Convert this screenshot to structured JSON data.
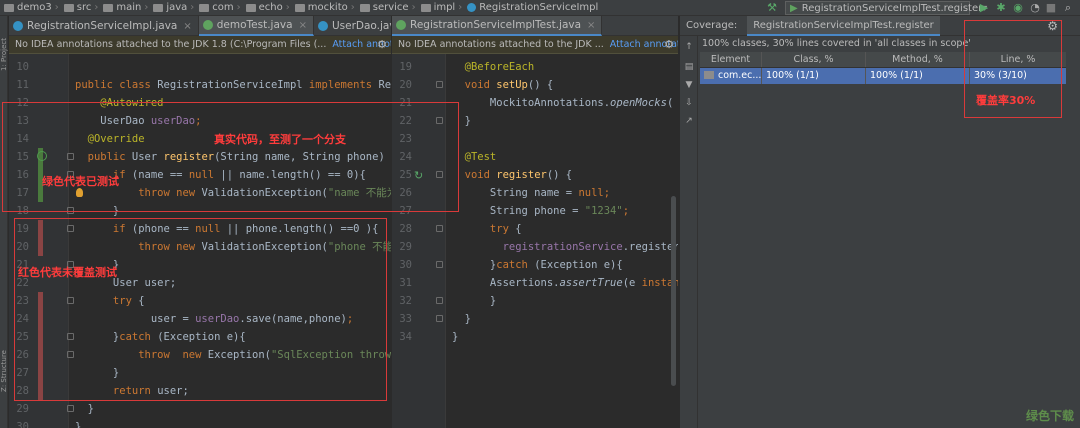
{
  "breadcrumb": [
    "demo3",
    "src",
    "main",
    "java",
    "com",
    "echo",
    "mockito",
    "service",
    "impl",
    "RegistrationServiceImpl"
  ],
  "toolbar": {
    "run_config": "RegistrationServiceImplTest.register"
  },
  "left_strip": {
    "project_label": "1: Project",
    "structure_label": "Z: Structure"
  },
  "left_editor": {
    "tabs": [
      {
        "label": "RegistrationServiceImpl.java",
        "active": false
      },
      {
        "label": "demoTest.java",
        "active": true
      },
      {
        "label": "UserDao.java",
        "active": false
      }
    ],
    "banner_text": "No IDEA annotations attached to the JDK 1.8 (C:\\Program Files (...",
    "banner_link": "Attach annotations",
    "lines": [
      {
        "n": "10",
        "segs": []
      },
      {
        "n": "11",
        "segs": [
          [
            "kw",
            "public class "
          ],
          [
            "id",
            "RegistrationServiceImpl "
          ],
          [
            "kw",
            "implements "
          ],
          [
            "id",
            "Registra"
          ]
        ]
      },
      {
        "n": "12",
        "segs": [
          [
            "ann",
            "    @Autowired"
          ]
        ]
      },
      {
        "n": "13",
        "segs": [
          [
            "id",
            "    UserDao "
          ],
          [
            "fld",
            "userDao"
          ],
          [
            "kw",
            ";"
          ]
        ]
      },
      {
        "n": "14",
        "segs": [
          [
            "ann",
            "  @Override"
          ]
        ]
      },
      {
        "n": "15",
        "segs": [
          [
            "kw",
            "  public "
          ],
          [
            "id",
            "User "
          ],
          [
            "fn",
            "register"
          ],
          [
            "id",
            "(String name, String phone) "
          ],
          [
            "kw",
            "thro"
          ]
        ]
      },
      {
        "n": "16",
        "segs": [
          [
            "kw",
            "      if "
          ],
          [
            "id",
            "(name == "
          ],
          [
            "kw",
            "null "
          ],
          [
            "id",
            "|| name.length() == "
          ],
          [
            "id",
            "0"
          ],
          [
            "id",
            "){"
          ]
        ]
      },
      {
        "n": "17",
        "segs": [
          [
            "kw",
            "          throw new "
          ],
          [
            "id",
            "ValidationException("
          ],
          [
            "str",
            "\"name 不能为空"
          ]
        ]
      },
      {
        "n": "18",
        "segs": [
          [
            "id",
            "      }"
          ]
        ]
      },
      {
        "n": "19",
        "segs": [
          [
            "kw",
            "      if "
          ],
          [
            "id",
            "(phone == "
          ],
          [
            "kw",
            "null "
          ],
          [
            "id",
            "|| phone.length() ==0 ){"
          ]
        ]
      },
      {
        "n": "20",
        "segs": [
          [
            "kw",
            "          throw new "
          ],
          [
            "id",
            "ValidationException("
          ],
          [
            "str",
            "\"phone 不能为空"
          ]
        ]
      },
      {
        "n": "21",
        "segs": [
          [
            "id",
            "      }"
          ]
        ]
      },
      {
        "n": "22",
        "segs": [
          [
            "id",
            "      User user;"
          ]
        ]
      },
      {
        "n": "23",
        "segs": [
          [
            "kw",
            "      try "
          ],
          [
            "id",
            "{"
          ]
        ]
      },
      {
        "n": "24",
        "segs": [
          [
            "id",
            "            user = "
          ],
          [
            "fld",
            "userDao"
          ],
          [
            "id",
            ".save(name,phone)"
          ],
          [
            "kw",
            ";"
          ]
        ]
      },
      {
        "n": "25",
        "segs": [
          [
            "id",
            "      }"
          ],
          [
            "kw",
            "catch "
          ],
          [
            "id",
            "(Exception e){"
          ]
        ]
      },
      {
        "n": "26",
        "segs": [
          [
            "kw",
            "          throw  new "
          ],
          [
            "id",
            "Exception("
          ],
          [
            "str",
            "\"SqlException thrown\""
          ]
        ]
      },
      {
        "n": "27",
        "segs": [
          [
            "id",
            "      }"
          ]
        ]
      },
      {
        "n": "28",
        "segs": [
          [
            "kw",
            "      return "
          ],
          [
            "id",
            "user;"
          ]
        ]
      },
      {
        "n": "29",
        "segs": [
          [
            "id",
            "  }"
          ]
        ]
      },
      {
        "n": "30",
        "segs": [
          [
            "id",
            "}"
          ]
        ]
      }
    ],
    "annotations": {
      "real_code": "真实代码，至测了一个分支",
      "green_note": "绿色代表已测试",
      "red_note": "红色代表未覆盖测试"
    }
  },
  "right_editor": {
    "tabs": [
      {
        "label": "RegistrationServiceImplTest.java",
        "active": true
      }
    ],
    "banner_text": "No IDEA annotations attached to the JDK ...",
    "banner_link": "Attach annotations",
    "lines": [
      {
        "n": "19",
        "segs": [
          [
            "ann",
            "  @BeforeEach"
          ]
        ]
      },
      {
        "n": "20",
        "segs": [
          [
            "kw",
            "  void "
          ],
          [
            "fn",
            "setUp"
          ],
          [
            "id",
            "() {"
          ]
        ]
      },
      {
        "n": "21",
        "segs": [
          [
            "id",
            "      MockitoAnnotations."
          ],
          [
            "it",
            "openMocks"
          ],
          [
            "id",
            "( "
          ],
          [
            "kw",
            "te"
          ]
        ]
      },
      {
        "n": "22",
        "segs": [
          [
            "id",
            "  }"
          ]
        ]
      },
      {
        "n": "23",
        "segs": []
      },
      {
        "n": "24",
        "segs": [
          [
            "ann",
            "  @Test"
          ]
        ]
      },
      {
        "n": "25",
        "segs": [
          [
            "kw",
            "  void "
          ],
          [
            "fn",
            "register"
          ],
          [
            "id",
            "() {"
          ]
        ]
      },
      {
        "n": "26",
        "segs": [
          [
            "id",
            "      String name = "
          ],
          [
            "kw",
            "null"
          ],
          [
            "kw",
            ";"
          ]
        ]
      },
      {
        "n": "27",
        "segs": [
          [
            "id",
            "      String phone = "
          ],
          [
            "str",
            "\"1234\""
          ],
          [
            "kw",
            ";"
          ]
        ]
      },
      {
        "n": "28",
        "segs": [
          [
            "kw",
            "      try "
          ],
          [
            "id",
            "{"
          ]
        ]
      },
      {
        "n": "29",
        "segs": [
          [
            "fld",
            "        registrationService"
          ],
          [
            "id",
            ".register(na"
          ]
        ]
      },
      {
        "n": "30",
        "segs": [
          [
            "id",
            "      }"
          ],
          [
            "kw",
            "catch "
          ],
          [
            "id",
            "(Exception e){"
          ]
        ]
      },
      {
        "n": "31",
        "segs": [
          [
            "id",
            "      Assertions."
          ],
          [
            "it",
            "assertTrue"
          ],
          [
            "id",
            "(e "
          ],
          [
            "kw",
            "instance"
          ]
        ]
      },
      {
        "n": "32",
        "segs": [
          [
            "id",
            "      }"
          ]
        ]
      },
      {
        "n": "33",
        "segs": [
          [
            "id",
            "  }"
          ]
        ]
      },
      {
        "n": "34",
        "segs": [
          [
            "id",
            "}"
          ]
        ]
      }
    ]
  },
  "coverage": {
    "title": "Coverage:",
    "tab": "RegistrationServiceImplTest.register",
    "summary": "100% classes, 30% lines covered in 'all classes in scope'",
    "columns": [
      "Element",
      "Class, %",
      "Method, %",
      "Line, %"
    ],
    "rows": [
      [
        "com.ec...",
        "100% (1/1)",
        "100% (1/1)",
        "30% (3/10)"
      ]
    ],
    "annotation": "覆盖率30%"
  },
  "watermark": "绿色下载"
}
